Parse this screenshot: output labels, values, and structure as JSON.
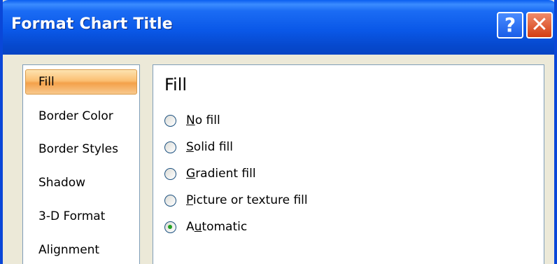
{
  "window": {
    "title": "Format Chart Title",
    "help_button": "?",
    "close_button": "✕"
  },
  "sidebar": {
    "items": [
      {
        "label": "Fill",
        "selected": true
      },
      {
        "label": "Border Color"
      },
      {
        "label": "Border Styles"
      },
      {
        "label": "Shadow"
      },
      {
        "label": "3-D Format"
      },
      {
        "label": "Alignment"
      }
    ]
  },
  "main": {
    "section_title": "Fill",
    "options": [
      {
        "accel": "N",
        "rest": "o fill",
        "label": "No fill",
        "selected": false
      },
      {
        "accel": "S",
        "rest": "olid fill",
        "label": "Solid fill",
        "selected": false
      },
      {
        "accel": "G",
        "rest": "radient fill",
        "label": "Gradient fill",
        "selected": false
      },
      {
        "accel": "P",
        "rest": "icture or texture fill",
        "label": "Picture or texture fill",
        "selected": false
      },
      {
        "prefix": "A",
        "accel": "u",
        "rest": "tomatic",
        "label": "Automatic",
        "selected": true
      }
    ]
  },
  "colors": {
    "titlebar": "#0a58e8",
    "selected_item": "#fbbf72",
    "radio_selected_dot": "#21a121",
    "dialog_bg": "#ece9d8"
  }
}
